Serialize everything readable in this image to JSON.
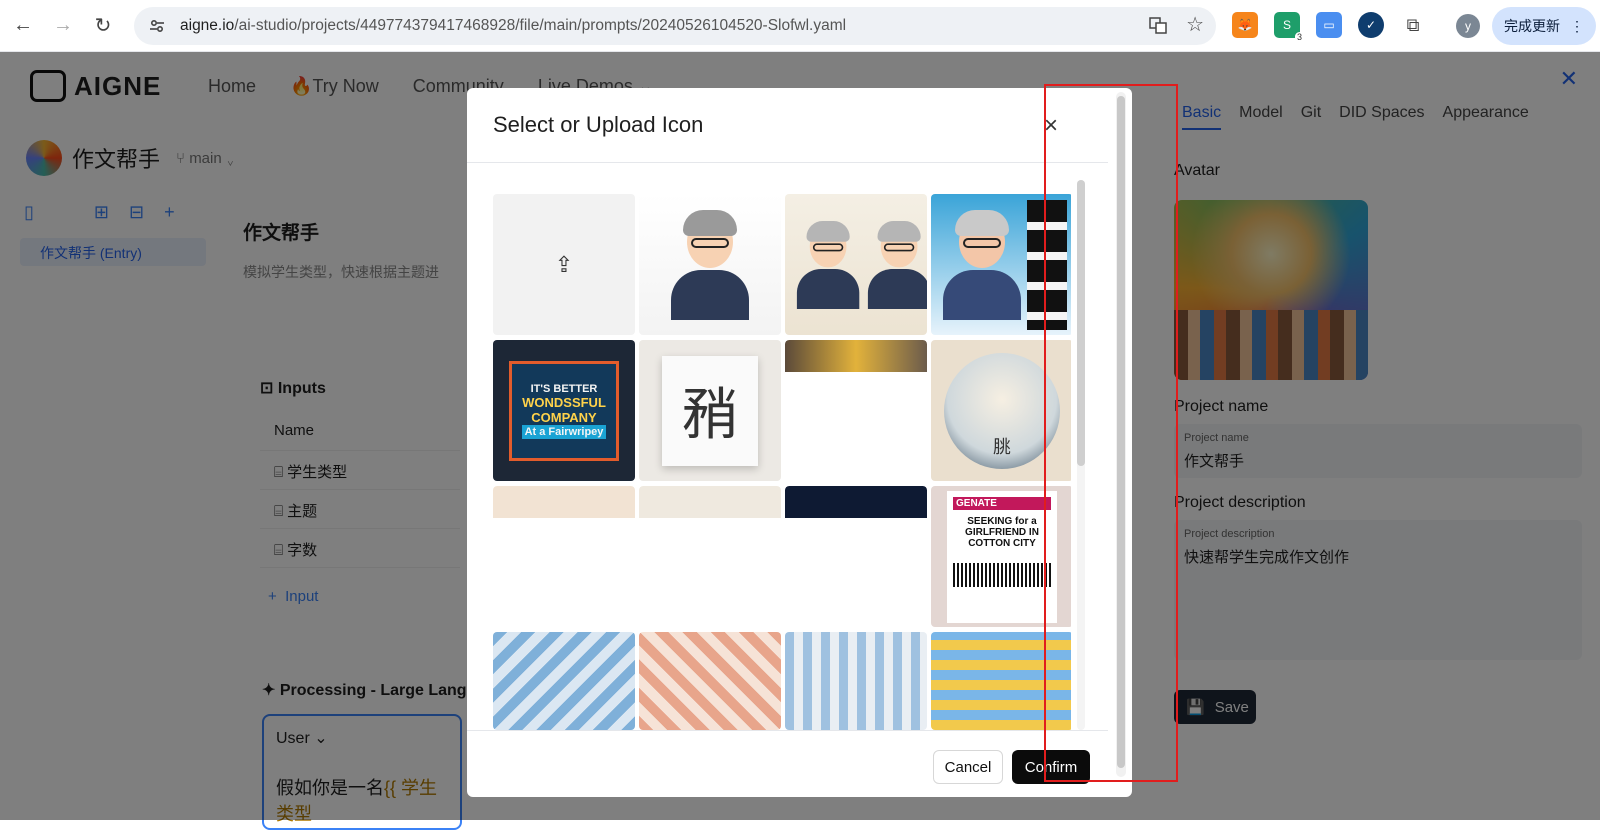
{
  "browser": {
    "url_host": "aigne.io",
    "url_path": "/ai-studio/projects/449774379417468928/file/main/prompts/20240526104520-Slofwl.yaml",
    "update_label": "完成更新",
    "profile_initial": "y",
    "ext_badge": "3"
  },
  "topnav": {
    "logo": "AIGNE",
    "links": [
      "Home",
      "Try Now",
      "Community",
      "Live Demos"
    ]
  },
  "project": {
    "name": "作文帮手",
    "branch": "main",
    "entry": "作文帮手 (Entry)",
    "title": "作文帮手",
    "description": "模拟学生类型，快速根据主题进"
  },
  "inputs": {
    "header": "Inputs",
    "column_name": "Name",
    "rows": [
      "学生类型",
      "主题",
      "字数"
    ],
    "add_label": "Input"
  },
  "processing": {
    "header": "Processing -  Large Lang",
    "role": "User",
    "text": "假如你是一名",
    "var": "{{ 学生类型"
  },
  "right_panel": {
    "tabs": [
      "Basic",
      "Model",
      "Git",
      "DID Spaces",
      "Appearance"
    ],
    "avatar_label": "Avatar",
    "project_name_label": "Project name",
    "project_name_field_label": "Project name",
    "project_name_value": "作文帮手",
    "project_desc_label": "Project description",
    "project_desc_field_label": "Project description",
    "project_desc_value": "快速帮学生完成作文创作",
    "save_label": "Save"
  },
  "modal": {
    "title": "Select or Upload Icon",
    "cancel_label": "Cancel",
    "confirm_label": "Confirm",
    "tiles": {
      "poster_lines": [
        "IT'S BETTER",
        "WONDSSFUL",
        "COMPANY",
        "At a Fairwripey"
      ],
      "char_glyph": "矟",
      "circle_glyph": "朓",
      "news_header": "GENATE",
      "news_title": "SEEKING for a GIRLFRIEND IN COTTON CITY"
    }
  },
  "colors": {
    "accent": "#2563eb",
    "annotation": "#e11d1d",
    "confirm_bg": "#0b0b0b"
  }
}
